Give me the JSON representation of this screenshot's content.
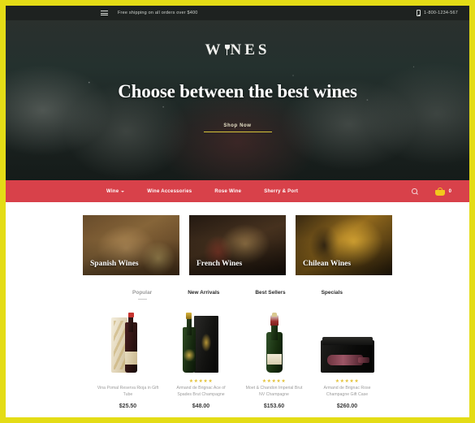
{
  "topbar": {
    "menu_icon": "hamburger-icon",
    "shipping_text": "Free shipping on all orders over $400",
    "phone_icon": "phone-icon",
    "phone": "1-800-1234-567"
  },
  "hero": {
    "brand_left": "W",
    "brand_icon": "wine-glass-icon",
    "brand_right": "NES",
    "headline": "Choose between the best wines",
    "cta_label": "Shop Now"
  },
  "nav": {
    "items": [
      {
        "label": "Wine",
        "has_dropdown": true
      },
      {
        "label": "Wine Accessories",
        "has_dropdown": false
      },
      {
        "label": "Rose Wine",
        "has_dropdown": false
      },
      {
        "label": "Sherry & Port",
        "has_dropdown": false
      }
    ],
    "search_icon": "search-icon",
    "cart_icon": "shopping-cart-icon",
    "cart_count": "0",
    "bar_color": "#d8414a",
    "cart_color": "#f2c91c"
  },
  "categories": [
    {
      "label": "Spanish Wines"
    },
    {
      "label": "French Wines"
    },
    {
      "label": "Chilean Wines"
    }
  ],
  "tabs": [
    {
      "label": "Popular",
      "active": true
    },
    {
      "label": "New Arrivals",
      "active": false
    },
    {
      "label": "Best Sellers",
      "active": false
    },
    {
      "label": "Specials",
      "active": false
    }
  ],
  "products": [
    {
      "name": "Vina Pomal Reserva Rioja in Gift Tube",
      "price": "$25.50",
      "stars": "",
      "image": "red-wine-bottle-with-gift-tube"
    },
    {
      "name": "Armand de Brignac Ace of Spades Brut Champagne",
      "price": "$48.00",
      "stars": "★★★★★",
      "image": "champagne-bottle-with-black-gift-box"
    },
    {
      "name": "Moet & Chandon Imperial Brut NV Champagne",
      "price": "$153.60",
      "stars": "★★★★★",
      "image": "green-champagne-bottle"
    },
    {
      "name": "Armand de Brignac Rose Champagne Gift Case",
      "price": "$260.00",
      "stars": "★★★★★",
      "image": "rose-champagne-in-presentation-case"
    }
  ],
  "theme": {
    "frame_color": "#e4dc16",
    "accent_red": "#d8414a",
    "accent_gold": "#f2c91c"
  }
}
